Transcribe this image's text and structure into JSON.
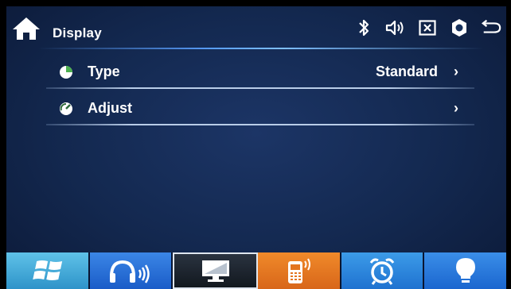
{
  "header": {
    "title": "Display"
  },
  "status_icons": [
    "bluetooth-icon",
    "volume-icon",
    "close-box-icon",
    "settings-icon",
    "back-icon"
  ],
  "menu": {
    "items": [
      {
        "label": "Type",
        "value": "Standard",
        "icon": "pie-chart-icon",
        "chevron": "›"
      },
      {
        "label": "Adjust",
        "value": "",
        "icon": "dial-icon",
        "chevron": "›"
      }
    ]
  },
  "dock": {
    "tiles": [
      {
        "name": "windows-icon",
        "color": "#3aa6d8"
      },
      {
        "name": "headphones-icon",
        "color": "#2a70d8"
      },
      {
        "name": "display-icon",
        "color": "#1c232c",
        "active": true
      },
      {
        "name": "phone-icon",
        "color": "#e67a22"
      },
      {
        "name": "alarm-clock-icon",
        "color": "#2c85dc"
      },
      {
        "name": "lightbulb-icon",
        "color": "#2a7ddc"
      }
    ]
  },
  "colors": {
    "background": "#13284f",
    "accent_line": "#5aa0ff",
    "divider": "#b9cde8"
  }
}
